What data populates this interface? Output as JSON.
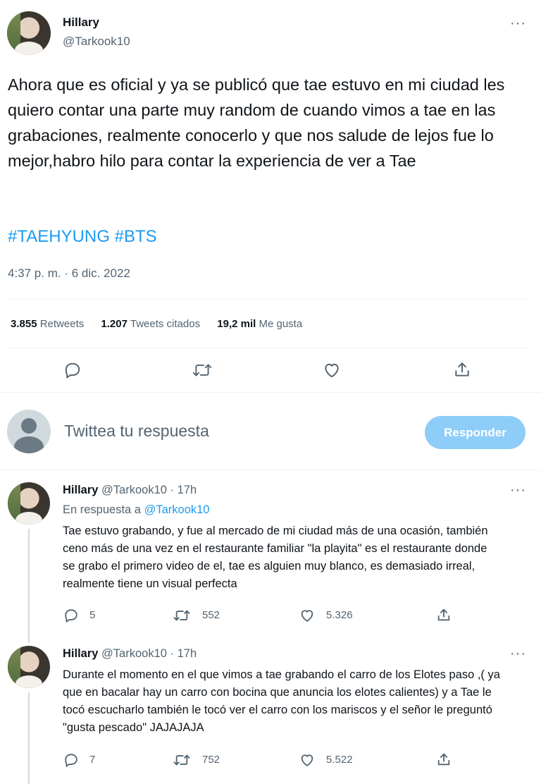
{
  "tweet": {
    "author_name": "Hillary",
    "author_handle": "@Tarkook10",
    "text": "Ahora que es oficial y ya se publicó que tae estuvo en mi ciudad les quiero contar una parte muy random de cuando vimos a tae en las grabaciones, realmente conocerlo y que nos salude de lejos fue lo mejor,habro hilo para contar la experiencia de ver a Tae",
    "hashtags": [
      "#TAEHYUNG",
      "#BTS"
    ],
    "timestamp": "4:37 p. m. · 6 dic. 2022",
    "stats": {
      "retweets_count": "3.855",
      "retweets_label": "Retweets",
      "quotes_count": "1.207",
      "quotes_label": "Tweets citados",
      "likes_count": "19,2 mil",
      "likes_label": "Me gusta"
    },
    "more": "···"
  },
  "reply_box": {
    "placeholder": "Twittea tu respuesta",
    "button_label": "Responder"
  },
  "replies": [
    {
      "author_name": "Hillary",
      "author_handle": "@Tarkook10",
      "time": "· 17h",
      "in_reply_prefix": "En respuesta a",
      "in_reply_handle": "@Tarkook10",
      "text": "Tae estuvo grabando, y fue al mercado de mi ciudad más de una ocasión, también ceno más de una vez en el restaurante familiar  \"la playita\" es el restaurante donde se grabo el primero video de el, tae es alguien muy blanco, es demasiado irreal, realmente tiene un visual perfecta",
      "replies_count": "5",
      "retweets_count": "552",
      "likes_count": "5.326",
      "more": "···"
    },
    {
      "author_name": "Hillary",
      "author_handle": "@Tarkook10",
      "time": "· 17h",
      "text": "Durante el momento en el que vimos a tae grabando el carro de los Elotes paso ,( ya que en bacalar hay un carro con bocina que anuncia los elotes calientes) y a Tae le tocó escucharlo también le tocó ver el carro con los mariscos y el señor le preguntó \"gusta pescado\" JAJAJAJA",
      "replies_count": "7",
      "retweets_count": "752",
      "likes_count": "5.522",
      "more": "···"
    }
  ],
  "colors": {
    "accent": "#1d9bf0",
    "button_disabled": "#8ecdf8",
    "muted": "#536471",
    "divider": "#eff3f4"
  },
  "icons": [
    "reply-icon",
    "retweet-icon",
    "like-icon",
    "share-icon",
    "more-icon",
    "default-avatar-icon"
  ]
}
